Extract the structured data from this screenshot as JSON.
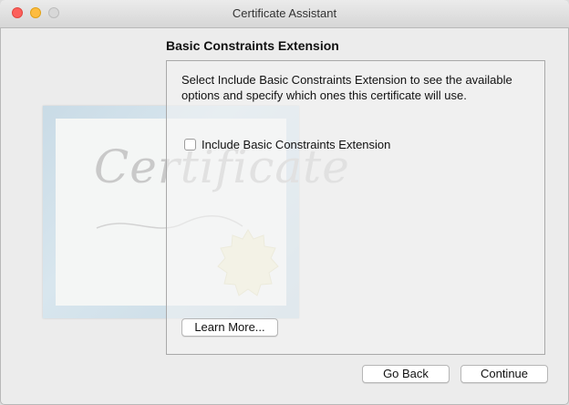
{
  "window": {
    "title": "Certificate Assistant"
  },
  "page": {
    "heading": "Basic Constraints Extension",
    "description": "Select Include Basic Constraints Extension to see the available options and specify which ones this certificate will use.",
    "checkbox": {
      "label": "Include Basic Constraints Extension",
      "checked": false
    },
    "learn_more_label": "Learn More..."
  },
  "watermark": {
    "text": "Certificate"
  },
  "footer": {
    "back_label": "Go Back",
    "continue_label": "Continue"
  }
}
